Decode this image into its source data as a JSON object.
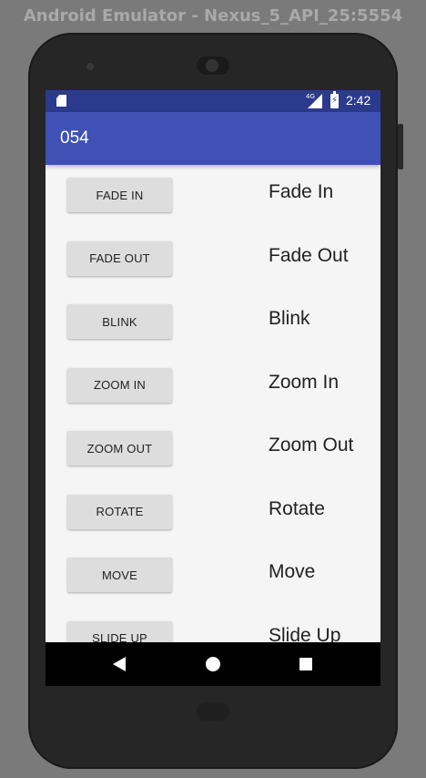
{
  "window": {
    "title": "Android Emulator - Nexus_5_API_25:5554"
  },
  "status_bar": {
    "time": "2:42",
    "network": "4G",
    "color": "#2c3a8d"
  },
  "app_bar": {
    "title": "054",
    "color": "#3f51b5"
  },
  "rows": [
    {
      "button": "FADE IN",
      "label": "Fade In"
    },
    {
      "button": "FADE OUT",
      "label": "Fade Out"
    },
    {
      "button": "BLINK",
      "label": "Blink"
    },
    {
      "button": "ZOOM IN",
      "label": "Zoom In"
    },
    {
      "button": "ZOOM OUT",
      "label": "Zoom Out"
    },
    {
      "button": "ROTATE",
      "label": "Rotate"
    },
    {
      "button": "MOVE",
      "label": "Move"
    },
    {
      "button": "SLIDE UP",
      "label": "Slide Up"
    }
  ],
  "nav_bar": {
    "back_icon": "triangle-back",
    "home_icon": "circle-home",
    "recents_icon": "square-recents"
  }
}
